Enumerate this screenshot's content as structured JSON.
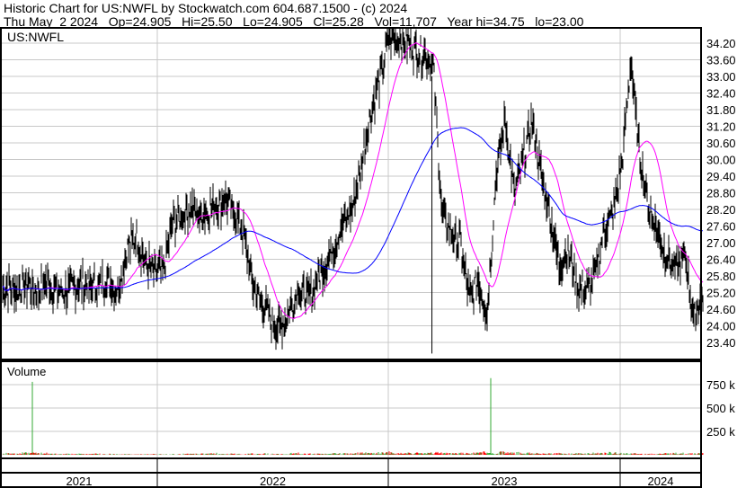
{
  "header": {
    "title": "Historic Chart for US:NWFL by Stockwatch.com 604.687.1500 - (c) 2024",
    "quote": "Thu May  2 2024   Op=24.905   Hi=25.50   Lo=24.905   Cl=25.28   Vol=11,707   Year hi=34.75   lo=23.00"
  },
  "colors": {
    "price": "#000000",
    "ma_short": "#ff00ff",
    "ma_long": "#0000ff",
    "vol_up": "#33aa33",
    "vol_down": "#ff0000",
    "grid": "#c8c8c8"
  },
  "chart_data": {
    "type": "line",
    "symbol": "US:NWFL",
    "volume_label": "Volume",
    "price_ticks": [
      "34.20",
      "33.60",
      "33.00",
      "32.40",
      "31.80",
      "31.20",
      "30.60",
      "30.00",
      "29.40",
      "28.80",
      "28.20",
      "27.60",
      "27.00",
      "26.40",
      "25.80",
      "25.20",
      "24.60",
      "24.00",
      "23.40"
    ],
    "ylim": [
      23.0,
      34.75
    ],
    "volume_ticks": [
      {
        "label": "750 k",
        "value": 750
      },
      {
        "label": "500 k",
        "value": 500
      },
      {
        "label": "250 k",
        "value": 250
      }
    ],
    "years": [
      "2021",
      "2022",
      "2023",
      "2024"
    ],
    "period": "biweekly approx, Apr 2021 - May 2024",
    "close": [
      25.4,
      25.3,
      25.5,
      25.2,
      25.6,
      25.3,
      25.2,
      25.4,
      25.5,
      25.4,
      25.5,
      25.6,
      25.4,
      26.8,
      27.2,
      26.2,
      26.0,
      25.9,
      27.8,
      27.9,
      28.3,
      27.9,
      28.2,
      28.4,
      28.5,
      28.0,
      27.2,
      25.3,
      24.8,
      24.2,
      23.9,
      24.5,
      25.3,
      25.0,
      25.6,
      26.2,
      27.0,
      27.6,
      28.3,
      29.8,
      31.6,
      32.8,
      34.3,
      34.4,
      34.2,
      34.0,
      33.8,
      33.4,
      28.0,
      27.3,
      27.0,
      25.0,
      25.6,
      24.4,
      29.4,
      31.4,
      28.8,
      30.0,
      31.4,
      29.5,
      28.0,
      26.2,
      26.7,
      25.5,
      25.2,
      25.8,
      27.5,
      28.0,
      29.8,
      33.5,
      30.0,
      28.3,
      27.3,
      26.5,
      26.0,
      26.6,
      24.2,
      25.28
    ],
    "volume_k": [
      30,
      25,
      40,
      780,
      35,
      20,
      15,
      18,
      20,
      15,
      22,
      18,
      15,
      12,
      10,
      12,
      14,
      10,
      12,
      15,
      18,
      20,
      25,
      35,
      15,
      20,
      18,
      22,
      20,
      25,
      18,
      20,
      30,
      35,
      25,
      20,
      22,
      30,
      25,
      35,
      40,
      30,
      45,
      60,
      30,
      35,
      40,
      35,
      45,
      40,
      30,
      35,
      40,
      90,
      820,
      60,
      50,
      45,
      40,
      35,
      30,
      35,
      30,
      25,
      28,
      30,
      35,
      45,
      40,
      30,
      25,
      20,
      22,
      25,
      30,
      50,
      35,
      30
    ]
  }
}
